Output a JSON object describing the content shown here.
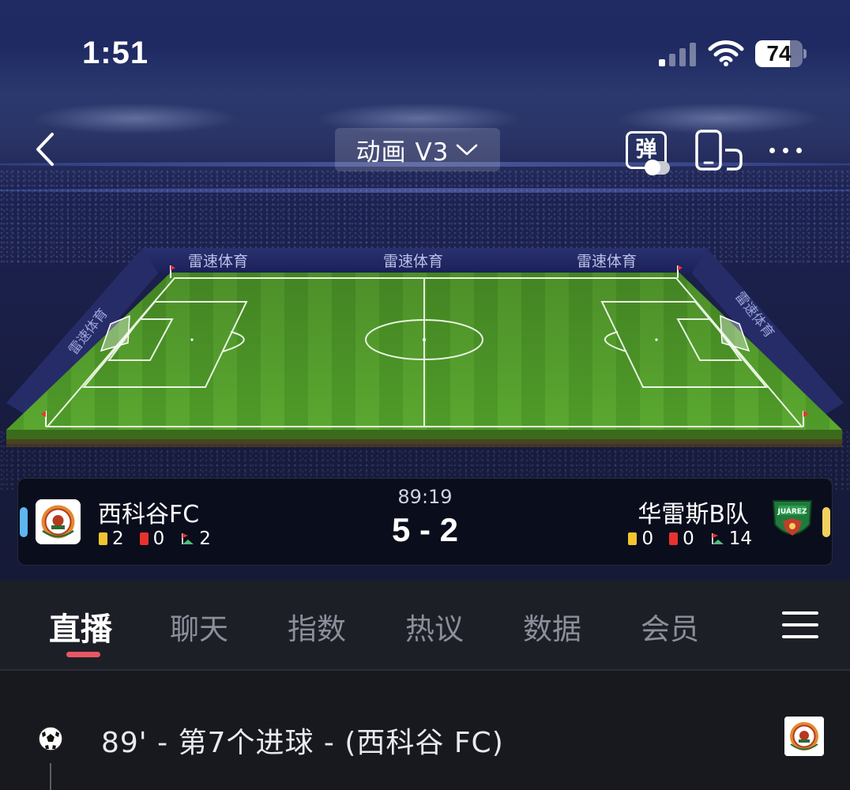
{
  "status_bar": {
    "time": "1:51",
    "battery_level": "74",
    "battery_fraction": 0.74
  },
  "header": {
    "mode_label": "动画 V3",
    "barrage_label": "弹"
  },
  "pitch": {
    "sponsor_text": "雷速体育"
  },
  "match": {
    "clock": "89:19",
    "score": "5 - 2",
    "home": {
      "name": "西科谷FC",
      "yellow_cards": "2",
      "red_cards": "0",
      "corners": "2",
      "marker_color": "#5fb6f2"
    },
    "away": {
      "name": "华雷斯B队",
      "yellow_cards": "0",
      "red_cards": "0",
      "corners": "14",
      "marker_color": "#f2d060",
      "crest_text": "JUÁREZ"
    }
  },
  "tabs": [
    {
      "label": "直播",
      "active": true
    },
    {
      "label": "聊天"
    },
    {
      "label": "指数"
    },
    {
      "label": "热议"
    },
    {
      "label": "数据"
    },
    {
      "label": "会员"
    }
  ],
  "feed": {
    "events": [
      {
        "text": "89' - 第7个进球 - (西科谷 FC)",
        "icon": "soccer-ball-icon"
      }
    ]
  },
  "colors": {
    "accent": "#e75763",
    "pitch_green": "#4e9a28",
    "yellow_card": "#f4c430",
    "red_card": "#e8322e"
  }
}
